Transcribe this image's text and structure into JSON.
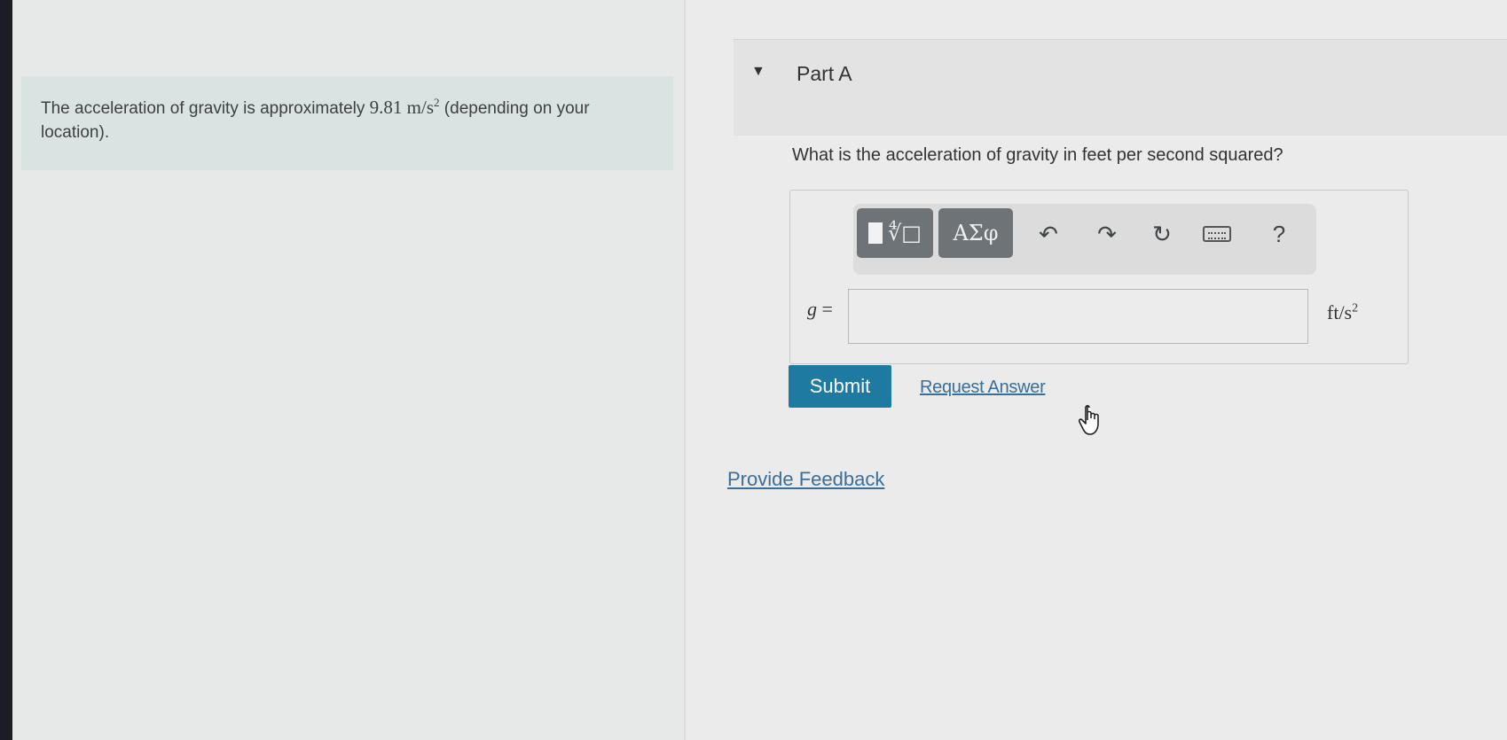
{
  "intro": {
    "text_before": "The acceleration of gravity is approximately ",
    "value": "9.81",
    "unit_base": "m/s",
    "unit_exp": "2",
    "text_after": " (depending on your location)."
  },
  "part": {
    "title": "Part A",
    "question": "What is the acceleration of gravity in feet per second squared?"
  },
  "toolbar": {
    "templates_label": "∜□",
    "symbols_label": "ΑΣφ",
    "undo_icon": "↶",
    "redo_icon": "↷",
    "reset_icon": "↻",
    "help_label": "?"
  },
  "answer": {
    "variable": "g",
    "equals": " =",
    "value": "",
    "placeholder": "",
    "unit_base": "ft/s",
    "unit_exp": "2"
  },
  "actions": {
    "submit_label": "Submit",
    "request_label": "Request Answer",
    "feedback_label": "Provide Feedback"
  },
  "colors": {
    "submit_bg": "#1e7aa0",
    "link": "#3a6f9a",
    "intro_bg": "#d9e3e1",
    "toolbar_btn": "#6d7376"
  }
}
